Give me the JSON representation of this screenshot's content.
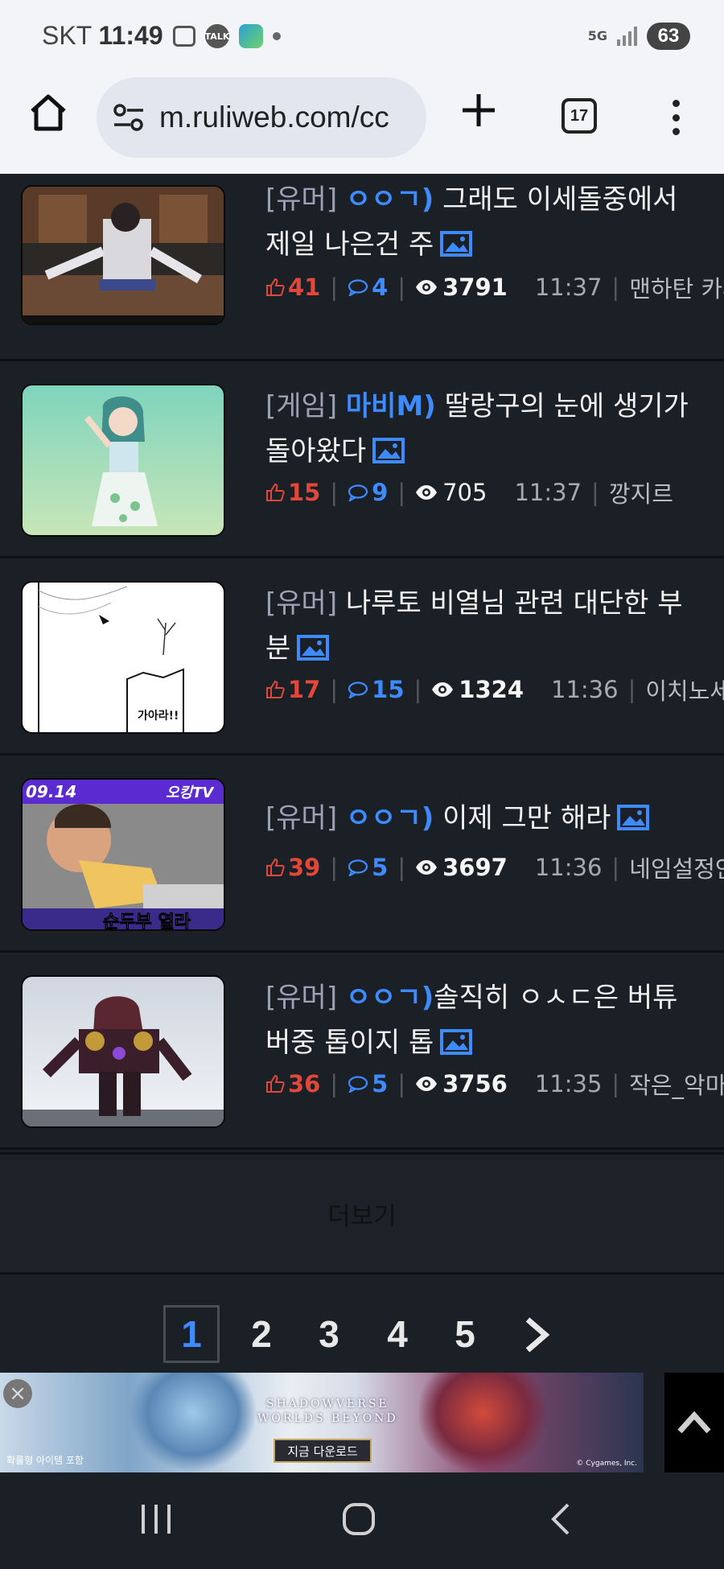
{
  "status_bar": {
    "carrier": "SKT",
    "time": "11:49",
    "network": "5G",
    "battery": "63",
    "notif_talk": "TALK"
  },
  "browser": {
    "url": "m.ruliweb.com/cc",
    "tab_count": "17"
  },
  "posts": [
    {
      "category": "[유머]",
      "tag": "ㅇㅇㄱ)",
      "title_line1": " 그래도 이세돌중에서",
      "title_line2": "제일 나은건 주",
      "likes": "41",
      "comments": "4",
      "views": "3791",
      "views_bold": true,
      "time": "11:37",
      "author": "맨하탄 카페"
    },
    {
      "category": "[게임]",
      "tag": "마비M)",
      "title_line1": " 딸랑구의 눈에 생기가",
      "title_line2": "돌아왔다",
      "likes": "15",
      "comments": "9",
      "views": "705",
      "views_bold": false,
      "time": "11:37",
      "author": "깡지르"
    },
    {
      "category": "[유머]",
      "tag": "",
      "title_line1": " 나루토 비열님 관련 대단한 부",
      "title_line2": "분",
      "likes": "17",
      "comments": "15",
      "views": "1324",
      "views_bold": true,
      "time": "11:36",
      "author": "이치노세군"
    },
    {
      "category": "[유머]",
      "tag": "ㅇㅇㄱ)",
      "title_line1": " 이제 그만 해라",
      "title_line2": "",
      "likes": "39",
      "comments": "5",
      "views": "3697",
      "views_bold": true,
      "time": "11:36",
      "author": "네임설정안내"
    },
    {
      "category": "[유머]",
      "tag": "ㅇㅇㄱ)",
      "title_line1": "솔직히 ㅇㅅㄷ은 버튜",
      "title_line2": "버중 톱이지 톱",
      "likes": "36",
      "comments": "5",
      "views": "3756",
      "views_bold": true,
      "time": "11:35",
      "author": "작은_악마"
    }
  ],
  "thumb_texts": {
    "t3_bubble": "가아라!!",
    "t4_date": "09.14",
    "t4_channel": "오킹TV",
    "t4_caption": "순두부 열라"
  },
  "more_label": "더보기",
  "pagination": {
    "pages": [
      "1",
      "2",
      "3",
      "4",
      "5"
    ],
    "active": "1"
  },
  "ad": {
    "brand_line1": "SHADOWVERSE",
    "brand_line2": "WORLDS BEYOND",
    "cta": "지금 다운로드",
    "small_text": "확률형 아이템 포함",
    "copyright": "© Cygames, Inc."
  },
  "colors": {
    "background": "#1b1f26",
    "accent_blue": "#3d8bff",
    "like_red": "#e2483a"
  }
}
